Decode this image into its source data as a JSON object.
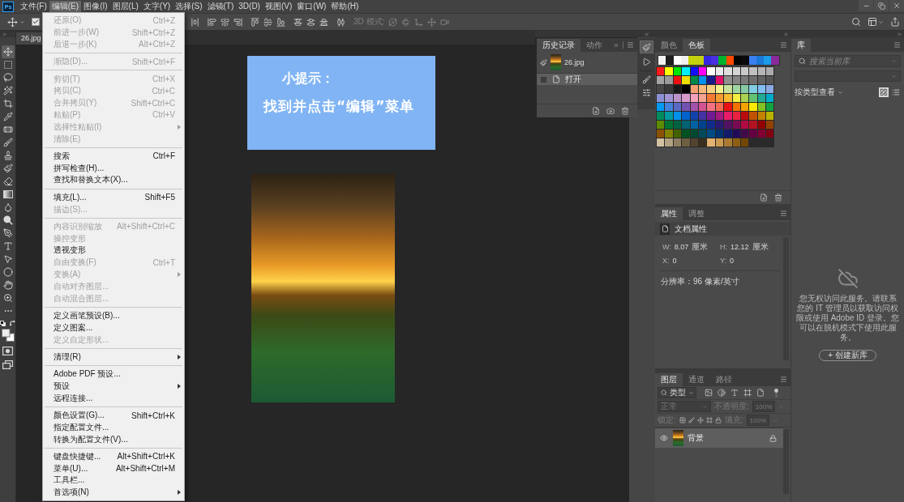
{
  "app_logo": "Ps",
  "menu_bar": [
    {
      "label": "文件(F)",
      "selected": false
    },
    {
      "label": "编辑(E)",
      "selected": true
    },
    {
      "label": "图像(I)",
      "selected": false
    },
    {
      "label": "图层(L)",
      "selected": false
    },
    {
      "label": "文字(Y)",
      "selected": false
    },
    {
      "label": "选择(S)",
      "selected": false
    },
    {
      "label": "滤镜(T)",
      "selected": false
    },
    {
      "label": "3D(D)",
      "selected": false
    },
    {
      "label": "视图(V)",
      "selected": false
    },
    {
      "label": "窗口(W)",
      "selected": false
    },
    {
      "label": "帮助(H)",
      "selected": false
    }
  ],
  "options_bar": {
    "auto_select": {
      "checked": true
    },
    "three_d_mode": {
      "label": "3D 模式:",
      "disabled": true
    }
  },
  "tools": [
    {
      "kind": "move",
      "selected": true
    },
    {
      "kind": "marquee",
      "selected": false
    },
    {
      "kind": "lasso",
      "selected": false
    },
    {
      "kind": "quick_select",
      "selected": false
    },
    {
      "kind": "crop",
      "selected": false
    },
    {
      "kind": "eyedropper",
      "selected": false
    },
    {
      "kind": "healing",
      "selected": false
    },
    {
      "kind": "brush",
      "selected": false
    },
    {
      "kind": "stamp",
      "selected": false
    },
    {
      "kind": "history_brush",
      "selected": false
    },
    {
      "kind": "eraser",
      "selected": false
    },
    {
      "kind": "gradient",
      "selected": false
    },
    {
      "kind": "blur",
      "selected": false
    },
    {
      "kind": "dodge",
      "selected": false
    },
    {
      "kind": "pen",
      "selected": false
    },
    {
      "kind": "type",
      "selected": false
    },
    {
      "kind": "path_select",
      "selected": false
    },
    {
      "kind": "shape",
      "selected": false
    },
    {
      "kind": "hand",
      "selected": false
    },
    {
      "kind": "zoom",
      "selected": false
    },
    {
      "kind": "more",
      "selected": false
    }
  ],
  "edit_menu": {
    "sections": [
      {
        "items": [
          {
            "label": "还原(O)",
            "shortcut": "Ctrl+Z",
            "disabled": true,
            "submenu": false
          },
          {
            "label": "前进一步(W)",
            "shortcut": "Shift+Ctrl+Z",
            "disabled": true,
            "submenu": false
          },
          {
            "label": "后退一步(K)",
            "shortcut": "Alt+Ctrl+Z",
            "disabled": true,
            "submenu": false
          }
        ]
      },
      {
        "items": [
          {
            "label": "渐隐(D)...",
            "shortcut": "Shift+Ctrl+F",
            "disabled": true,
            "submenu": false
          }
        ]
      },
      {
        "items": [
          {
            "label": "剪切(T)",
            "shortcut": "Ctrl+X",
            "disabled": true,
            "submenu": false
          },
          {
            "label": "拷贝(C)",
            "shortcut": "Ctrl+C",
            "disabled": true,
            "submenu": false
          },
          {
            "label": "合并拷贝(Y)",
            "shortcut": "Shift+Ctrl+C",
            "disabled": true,
            "submenu": false
          },
          {
            "label": "粘贴(P)",
            "shortcut": "Ctrl+V",
            "disabled": true,
            "submenu": false
          },
          {
            "label": "选择性粘贴(I)",
            "disabled": true,
            "submenu": true
          },
          {
            "label": "清除(E)",
            "disabled": true,
            "submenu": false
          }
        ]
      },
      {
        "items": [
          {
            "label": "搜索",
            "shortcut": "Ctrl+F",
            "disabled": false,
            "submenu": false
          },
          {
            "label": "拼写检查(H)...",
            "disabled": false,
            "submenu": false
          },
          {
            "label": "查找和替换文本(X)...",
            "disabled": false,
            "submenu": false
          }
        ]
      },
      {
        "items": [
          {
            "label": "填充(L)...",
            "shortcut": "Shift+F5",
            "disabled": false,
            "submenu": false
          },
          {
            "label": "描边(S)...",
            "disabled": true,
            "submenu": false
          }
        ]
      },
      {
        "items": [
          {
            "label": "内容识别缩放",
            "shortcut": "Alt+Shift+Ctrl+C",
            "disabled": true,
            "submenu": false
          },
          {
            "label": "操控变形",
            "disabled": true,
            "submenu": false
          },
          {
            "label": "透视变形",
            "disabled": false,
            "submenu": false
          },
          {
            "label": "自由变换(F)",
            "shortcut": "Ctrl+T",
            "disabled": true,
            "submenu": false
          },
          {
            "label": "变换(A)",
            "disabled": true,
            "submenu": true
          },
          {
            "label": "自动对齐图层...",
            "disabled": true,
            "submenu": false
          },
          {
            "label": "自动混合图层...",
            "disabled": true,
            "submenu": false
          }
        ]
      },
      {
        "items": [
          {
            "label": "定义画笔预设(B)...",
            "disabled": false,
            "submenu": false
          },
          {
            "label": "定义图案...",
            "disabled": false,
            "submenu": false
          },
          {
            "label": "定义自定形状...",
            "disabled": true,
            "submenu": false
          }
        ]
      },
      {
        "items": [
          {
            "label": "清理(R)",
            "disabled": false,
            "submenu": true
          }
        ]
      },
      {
        "items": [
          {
            "label": "Adobe PDF 预设...",
            "disabled": false,
            "submenu": false
          },
          {
            "label": "预设",
            "disabled": false,
            "submenu": true
          },
          {
            "label": "远程连接...",
            "disabled": false,
            "submenu": false
          }
        ]
      },
      {
        "items": [
          {
            "label": "颜色设置(G)...",
            "shortcut": "Shift+Ctrl+K",
            "disabled": false,
            "submenu": false
          },
          {
            "label": "指定配置文件...",
            "disabled": false,
            "submenu": false
          },
          {
            "label": "转换为配置文件(V)...",
            "disabled": false,
            "submenu": false
          }
        ]
      },
      {
        "items": [
          {
            "label": "键盘快捷键...",
            "shortcut": "Alt+Shift+Ctrl+K",
            "disabled": false,
            "submenu": false
          },
          {
            "label": "菜单(U)...",
            "shortcut": "Alt+Shift+Ctrl+M",
            "disabled": false,
            "submenu": false
          },
          {
            "label": "工具栏...",
            "disabled": false,
            "submenu": false
          },
          {
            "label": "首选项(N)",
            "disabled": false,
            "submenu": true
          }
        ]
      }
    ]
  },
  "document_tabs": [
    {
      "label": "26.jpg",
      "selected": true
    }
  ],
  "canvas": {
    "tip_card": {
      "title": "小提示：",
      "text": "找到并点击“编辑”菜单"
    }
  },
  "history_panel": {
    "tabs": [
      {
        "label": "历史记录",
        "selected": true
      },
      {
        "label": "动作",
        "selected": false
      }
    ],
    "snapshot": {
      "label": "26.jpg",
      "source": true
    },
    "states": [
      {
        "label": "打开",
        "selected": true,
        "source": false
      }
    ]
  },
  "swatches_panel": {
    "tabs": [
      {
        "label": "颜色",
        "selected": false
      },
      {
        "label": "色板",
        "selected": true
      }
    ],
    "recent": [
      {
        "color": "#f2f2f2"
      },
      {
        "color": "#1f1f1f"
      },
      {
        "color": "#ffffff"
      },
      {
        "color": "#f0f0f0"
      },
      {
        "color": "#c6d30a"
      },
      {
        "color": "#c2cf12"
      },
      {
        "color": "#3526e0"
      },
      {
        "color": "#4a2fe0"
      },
      {
        "color": "#00b22d"
      },
      {
        "color": "#ff4a00"
      },
      {
        "color": "#050505"
      },
      {
        "color": "#0a0a0a"
      },
      {
        "color": "#3b7ff0"
      },
      {
        "color": "#1b78d6"
      },
      {
        "color": "#1c9be6"
      },
      {
        "color": "#8a2a9a"
      }
    ],
    "swatches": [
      {
        "color": "#ff1a1a"
      },
      {
        "color": "#ffff00"
      },
      {
        "color": "#00e600"
      },
      {
        "color": "#00f0ff"
      },
      {
        "color": "#1010ff"
      },
      {
        "color": "#ff00ff"
      },
      {
        "color": "#ffffff"
      },
      {
        "color": "#ebebeb"
      },
      {
        "color": "#dedede"
      },
      {
        "color": "#d4d4d4"
      },
      {
        "color": "#cacaca"
      },
      {
        "color": "#c0c0c0"
      },
      {
        "color": "#b6b6b6"
      },
      {
        "color": "#acacac"
      },
      {
        "color": "#a3a3a3"
      },
      {
        "color": "#999999"
      },
      {
        "color": "#ee1111"
      },
      {
        "color": "#eedd00"
      },
      {
        "color": "#00884a"
      },
      {
        "color": "#0090ee"
      },
      {
        "color": "#1a1a8c"
      },
      {
        "color": "#e0106a"
      },
      {
        "color": "#8f8f8f"
      },
      {
        "color": "#858585"
      },
      {
        "color": "#7a7a7a"
      },
      {
        "color": "#6e6e6e"
      },
      {
        "color": "#626262"
      },
      {
        "color": "#565656"
      },
      {
        "color": "#474747"
      },
      {
        "color": "#383838"
      },
      {
        "color": "#181818"
      },
      {
        "color": "#000000"
      },
      {
        "color": "#f4a070"
      },
      {
        "color": "#f6b87c"
      },
      {
        "color": "#f8cf80"
      },
      {
        "color": "#f4f08c"
      },
      {
        "color": "#c6e29c"
      },
      {
        "color": "#a0d6a0"
      },
      {
        "color": "#84caa4"
      },
      {
        "color": "#80cce2"
      },
      {
        "color": "#80bef4"
      },
      {
        "color": "#8caae2"
      },
      {
        "color": "#8c90d2"
      },
      {
        "color": "#a294d2"
      },
      {
        "color": "#ba92ca"
      },
      {
        "color": "#d89aca"
      },
      {
        "color": "#f4a2ba"
      },
      {
        "color": "#f4a292"
      },
      {
        "color": "#f27a32"
      },
      {
        "color": "#f49c32"
      },
      {
        "color": "#f8ba32"
      },
      {
        "color": "#f2ee42"
      },
      {
        "color": "#aad252"
      },
      {
        "color": "#62c272"
      },
      {
        "color": "#22aa92"
      },
      {
        "color": "#00aaca"
      },
      {
        "color": "#009af2"
      },
      {
        "color": "#4282da"
      },
      {
        "color": "#5a6ac2"
      },
      {
        "color": "#7252b2"
      },
      {
        "color": "#a252aa"
      },
      {
        "color": "#d25292"
      },
      {
        "color": "#f27282"
      },
      {
        "color": "#f26a52"
      },
      {
        "color": "#ea1212"
      },
      {
        "color": "#f27200"
      },
      {
        "color": "#f8a200"
      },
      {
        "color": "#f8ea00"
      },
      {
        "color": "#82c222"
      },
      {
        "color": "#12a242"
      },
      {
        "color": "#008c5c"
      },
      {
        "color": "#009aa2"
      },
      {
        "color": "#0092ea"
      },
      {
        "color": "#0062ca"
      },
      {
        "color": "#1242aa"
      },
      {
        "color": "#4232a2"
      },
      {
        "color": "#721a92"
      },
      {
        "color": "#a21a82"
      },
      {
        "color": "#ea1a6a"
      },
      {
        "color": "#ea2242"
      },
      {
        "color": "#ba0c0c"
      },
      {
        "color": "#c25200"
      },
      {
        "color": "#c28200"
      },
      {
        "color": "#bab200"
      },
      {
        "color": "#5c8c00"
      },
      {
        "color": "#007232"
      },
      {
        "color": "#006242"
      },
      {
        "color": "#006272"
      },
      {
        "color": "#0062a2"
      },
      {
        "color": "#00428c"
      },
      {
        "color": "#122a8c"
      },
      {
        "color": "#2a1a72"
      },
      {
        "color": "#521262"
      },
      {
        "color": "#7a0a52"
      },
      {
        "color": "#b20a42"
      },
      {
        "color": "#b21222"
      },
      {
        "color": "#920000"
      },
      {
        "color": "#924200"
      },
      {
        "color": "#8a5200"
      },
      {
        "color": "#828200"
      },
      {
        "color": "#426200"
      },
      {
        "color": "#005222"
      },
      {
        "color": "#004a32"
      },
      {
        "color": "#004a5a"
      },
      {
        "color": "#004a82"
      },
      {
        "color": "#003272"
      },
      {
        "color": "#121a6a"
      },
      {
        "color": "#220a5a"
      },
      {
        "color": "#420a4a"
      },
      {
        "color": "#620042"
      },
      {
        "color": "#820032"
      },
      {
        "color": "#820012"
      },
      {
        "color": "#d2c2a2"
      },
      {
        "color": "#b2a282"
      },
      {
        "color": "#8e7e62"
      },
      {
        "color": "#6e5e42"
      },
      {
        "color": "#52422e"
      },
      {
        "color": "#3a2e1e"
      },
      {
        "color": "#e2b272"
      },
      {
        "color": "#ca9a52"
      },
      {
        "color": "#aa7a32"
      },
      {
        "color": "#8e5e12"
      },
      {
        "color": "#724602"
      }
    ]
  },
  "properties_panel": {
    "tabs": [
      {
        "label": "属性",
        "selected": true
      },
      {
        "label": "调整",
        "selected": false
      }
    ],
    "section": "文档属性",
    "fields": [
      {
        "label": "W:",
        "value": "8.07",
        "unit": "厘米"
      },
      {
        "label": "H:",
        "value": "12.12",
        "unit": "厘米"
      },
      {
        "label": "X:",
        "value": "0"
      },
      {
        "label": "Y:",
        "value": "0"
      }
    ],
    "resolution": "分辨率：96 像素/英寸"
  },
  "layers_panel": {
    "tabs": [
      {
        "label": "图层",
        "selected": true
      },
      {
        "label": "通道",
        "selected": false
      },
      {
        "label": "路径",
        "selected": false
      }
    ],
    "filter": {
      "placeholder": "类型"
    },
    "blend_mode": {
      "value": "正常",
      "disabled": true
    },
    "opacity": {
      "label": "不透明度:",
      "value": "100%",
      "disabled": true
    },
    "lock_label": "锁定:",
    "fill": {
      "label": "填充:",
      "value": "100%",
      "disabled": true
    },
    "layers": [
      {
        "name": "背景",
        "visible": true,
        "locked": true,
        "selected": true
      }
    ]
  },
  "library_panel": {
    "tabs": [
      {
        "label": "库",
        "selected": true
      }
    ],
    "search": {
      "placeholder": "搜索当前库"
    },
    "view_label": "按类型查看",
    "view_modes": [
      {
        "kind": "grid",
        "selected": true
      },
      {
        "kind": "list",
        "selected": false
      }
    ],
    "message": "您无权访问此服务。请联系您的 IT 管理员以获取访问权限或使用 Adobe ID 登录。您可以在脱机模式下使用此服务。",
    "create_button": "+ 创建新库"
  }
}
